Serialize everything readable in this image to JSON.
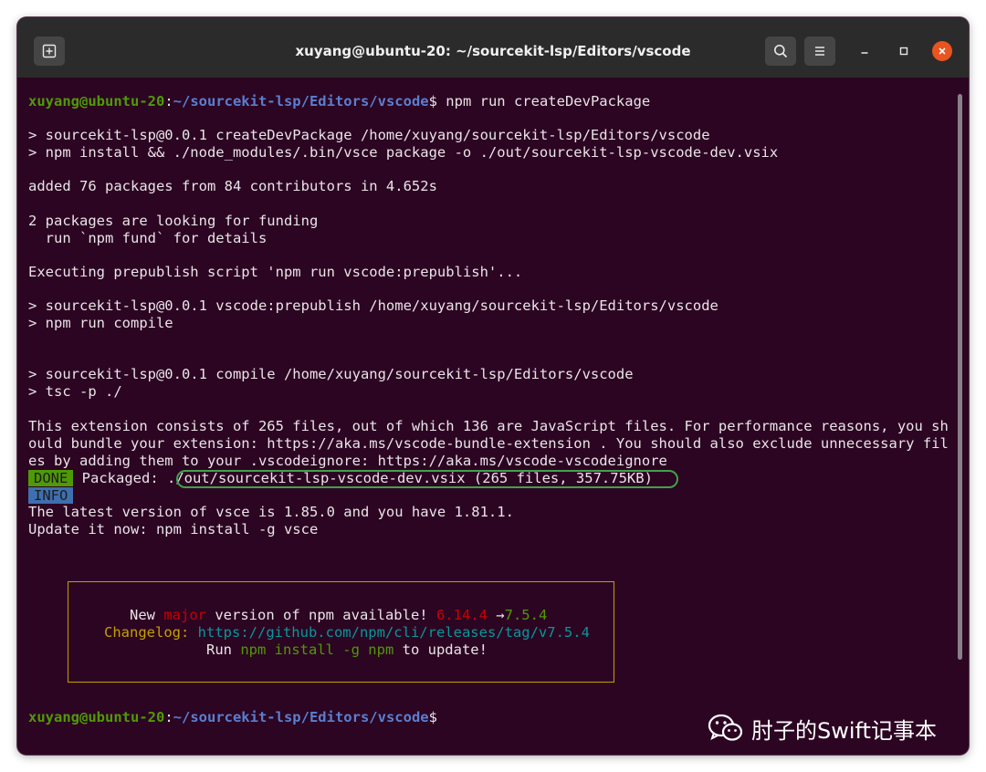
{
  "window": {
    "title": "xuyang@ubuntu-20: ~/sourcekit-lsp/Editors/vscode",
    "buttons": {
      "new_tab_icon": "new-tab-icon",
      "search_icon": "search-icon",
      "menu_icon": "hamburger-menu-icon",
      "minimize_icon": "minimize-icon",
      "maximize_icon": "maximize-icon",
      "close_icon": "close-icon"
    }
  },
  "terminal": {
    "prompt_user": "xuyang@ubuntu-20",
    "prompt_sep": ":",
    "prompt_path": "~/sourcekit-lsp/Editors/vscode",
    "prompt_end": "$",
    "command": " npm run createDevPackage",
    "lines": [
      "> sourcekit-lsp@0.0.1 createDevPackage /home/xuyang/sourcekit-lsp/Editors/vscode",
      "> npm install && ./node_modules/.bin/vsce package -o ./out/sourcekit-lsp-vscode-dev.vsix",
      "added 76 packages from 84 contributors in 4.652s",
      "2 packages are looking for funding",
      "  run `npm fund` for details",
      "Executing prepublish script 'npm run vscode:prepublish'...",
      "> sourcekit-lsp@0.0.1 vscode:prepublish /home/xuyang/sourcekit-lsp/Editors/vscode",
      "> npm run compile",
      "> sourcekit-lsp@0.0.1 compile /home/xuyang/sourcekit-lsp/Editors/vscode",
      "> tsc -p ./",
      "This extension consists of 265 files, out of which 136 are JavaScript files. For performance reasons, you sh",
      "ould bundle your extension: https://aka.ms/vscode-bundle-extension . You should also exclude unnecessary fil",
      "es by adding them to your .vscodeignore: https://aka.ms/vscode-vscodeignore"
    ],
    "done_badge": "DONE",
    "packaged_label": " Packaged: ",
    "packaged_value": "./out/sourcekit-lsp-vscode-dev.vsix (265 files, 357.75KB)",
    "info_badge": "INFO",
    "info_lines": [
      "The latest version of vsce is 1.85.0 and you have 1.81.1.",
      "Update it now: npm install -g vsce"
    ]
  },
  "npm_notice": {
    "line1_a": "New ",
    "line1_major": "major",
    "line1_b": " version of npm available! ",
    "old_version": "6.14.4",
    "arrow": " →",
    "new_version": "7.5.4",
    "changelog_label": "Changelog:",
    "changelog_url": " https://github.com/npm/cli/releases/tag/v7.5.4",
    "run_label": "Run ",
    "run_cmd": "npm install -g npm",
    "run_end": " to update!"
  },
  "watermark": {
    "icon": "wechat-icon",
    "text": "肘子的Swift记事本"
  },
  "colors": {
    "terminal_bg": "#2c0522",
    "titlebar_bg": "#2b2b2b",
    "prompt_green": "#4e9a06",
    "prompt_blue": "#5a7fd0",
    "close_orange": "#e95420",
    "highlight_green": "#3ea24a",
    "notice_border": "#c4a000"
  }
}
